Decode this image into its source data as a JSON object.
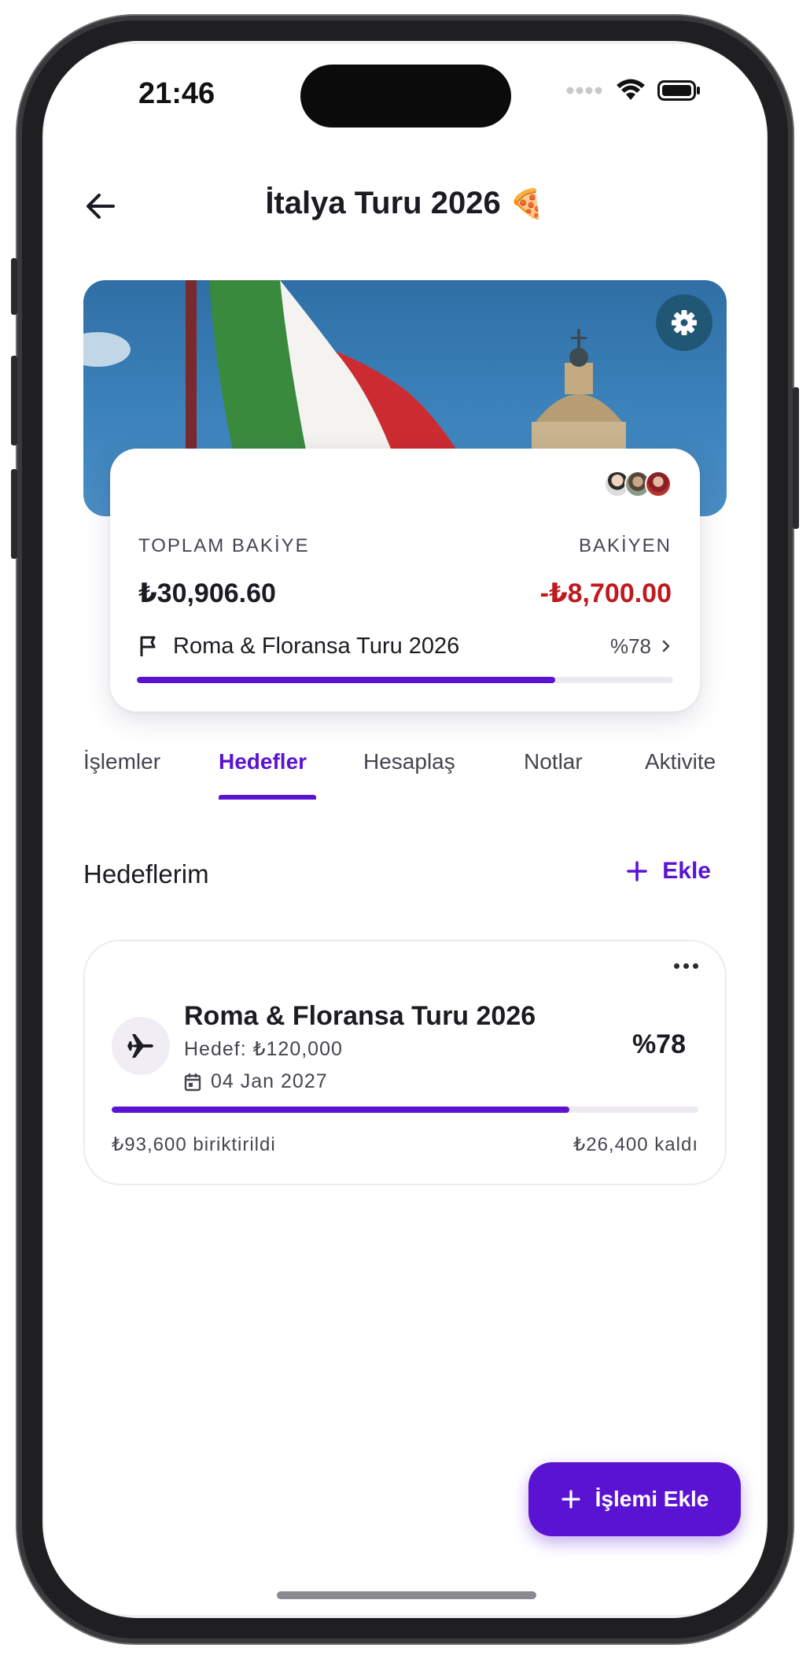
{
  "status_bar": {
    "time": "21:46"
  },
  "header": {
    "title": "İtalya Turu 2026",
    "title_emoji": "🍕"
  },
  "summary": {
    "total_label": "TOPLAM BAKİYE",
    "total_value": "₺30,906.60",
    "balance_label": "BAKİYEN",
    "balance_value": "-₺8,700.00",
    "goal_name": "Roma & Floransa Turu 2026",
    "goal_percent_text": "%78",
    "goal_progress": 0.78
  },
  "tabs": [
    {
      "label": "İşlemler"
    },
    {
      "label": "Hedefler",
      "active": true
    },
    {
      "label": "Hesaplaş"
    },
    {
      "label": "Notlar"
    },
    {
      "label": "Aktivite"
    }
  ],
  "goals_section": {
    "title": "Hedeflerim",
    "add_label": "Ekle"
  },
  "goal_card": {
    "name": "Roma & Floransa Turu 2026",
    "target": "Hedef: ₺120,000",
    "date": "04 Jan 2027",
    "percent_text": "%78",
    "progress": 0.78,
    "saved": "₺93,600 biriktirildi",
    "remaining": "₺26,400 kaldı"
  },
  "fab": {
    "label": "İşlemi Ekle"
  },
  "colors": {
    "accent": "#5b13d3",
    "negative": "#c0191e",
    "flag_green": "#3a8a3e",
    "flag_white": "#f4f3ef",
    "flag_red": "#cc2c31"
  }
}
